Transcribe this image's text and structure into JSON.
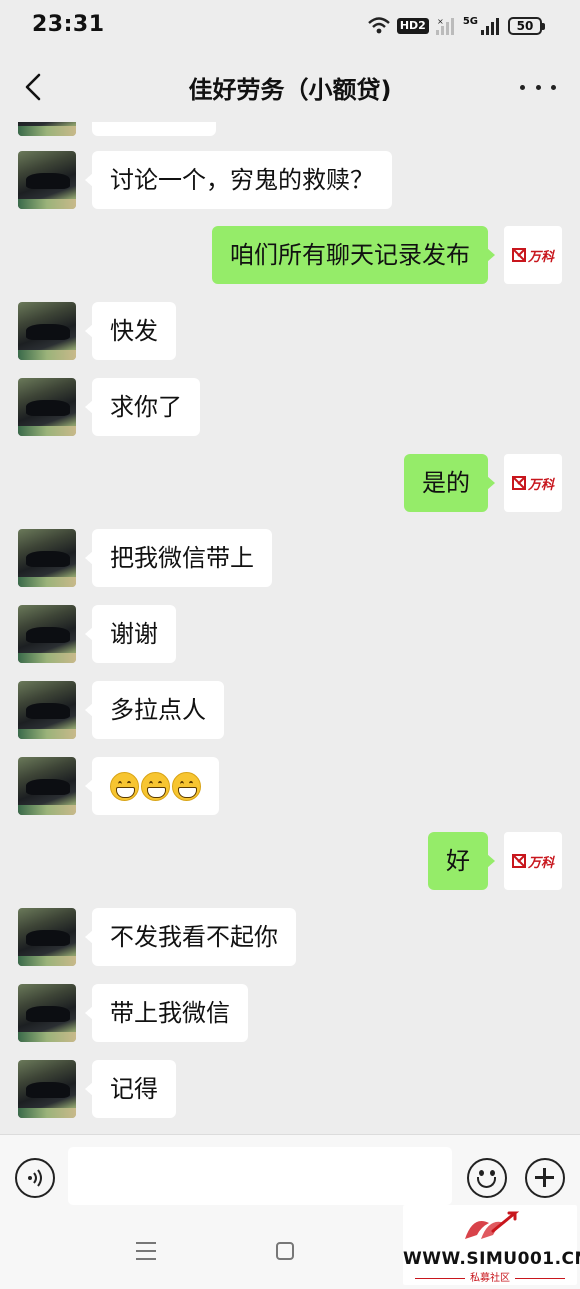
{
  "status_bar": {
    "time": "23:31",
    "hd_label": "HD2",
    "network_label": "5G",
    "battery": "50"
  },
  "header": {
    "title": "佳好劳务（小额贷)"
  },
  "brand": {
    "vanke_logo_text": "万科",
    "accent_red": "#c8161d",
    "bubble_green": "#95ec69"
  },
  "messages": [
    {
      "side": "left",
      "text": "讨论一个，穷鬼的救赎？"
    },
    {
      "side": "right",
      "text": "咱们所有聊天记录发布"
    },
    {
      "side": "left",
      "text": "快发"
    },
    {
      "side": "left",
      "text": "求你了"
    },
    {
      "side": "right",
      "text": "是的"
    },
    {
      "side": "left",
      "text": "把我微信带上"
    },
    {
      "side": "left",
      "text": "谢谢"
    },
    {
      "side": "left",
      "text": "多拉点人"
    },
    {
      "side": "left",
      "text": "",
      "emoji": "grin-icon x3"
    },
    {
      "side": "right",
      "text": "好"
    },
    {
      "side": "left",
      "text": "不发我看不起你"
    },
    {
      "side": "left",
      "text": "带上我微信"
    },
    {
      "side": "left",
      "text": "记得"
    }
  ],
  "watermark": {
    "url": "WWW.SIMU001.CN",
    "subtitle": "私募社区"
  }
}
